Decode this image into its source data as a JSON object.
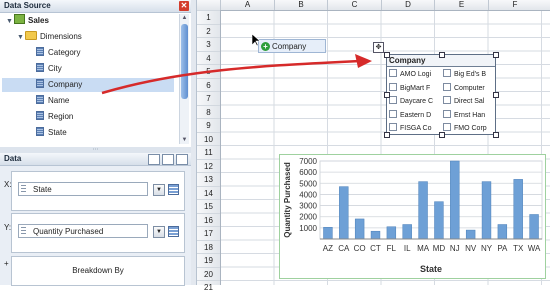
{
  "data_source": {
    "title": "Data Source",
    "tree": [
      {
        "label": "Sales",
        "indent": 0,
        "kind": "cube",
        "expanded": true
      },
      {
        "label": "Dimensions",
        "indent": 1,
        "kind": "folder",
        "expanded": true
      },
      {
        "label": "Category",
        "indent": 2,
        "kind": "field"
      },
      {
        "label": "City",
        "indent": 2,
        "kind": "field"
      },
      {
        "label": "Company",
        "indent": 2,
        "kind": "field",
        "selected": true
      },
      {
        "label": "Name",
        "indent": 2,
        "kind": "field"
      },
      {
        "label": "Region",
        "indent": 2,
        "kind": "field"
      },
      {
        "label": "State",
        "indent": 2,
        "kind": "field"
      }
    ]
  },
  "data_panel": {
    "title": "Data",
    "x_label": "X:",
    "x_value": "State",
    "y_label": "Y:",
    "y_value": "Quantity Purchased",
    "plus_label": "+",
    "breakdown_label": "Breakdown By"
  },
  "sheet": {
    "columns": [
      "A",
      "B",
      "C",
      "D",
      "E",
      "F"
    ],
    "rows": [
      "1",
      "2",
      "3",
      "4",
      "5",
      "6",
      "7",
      "8",
      "9",
      "10",
      "11",
      "12",
      "13",
      "14",
      "15",
      "16",
      "17",
      "18",
      "19",
      "20",
      "21"
    ]
  },
  "drag_chip": {
    "label": "Company"
  },
  "list_widget": {
    "title": "Company",
    "items_left": [
      "AMO Logi",
      "BigMart F",
      "Daycare C",
      "Eastern D",
      "FISGA Co"
    ],
    "items_right": [
      "Big Ed's B",
      "Computer",
      "Direct Sal",
      "Ernst Han",
      "FMO Corp"
    ]
  },
  "chart_data": {
    "type": "bar",
    "xlabel": "State",
    "ylabel": "Quantity Purchased",
    "categories": [
      "AZ",
      "CA",
      "CO",
      "CT",
      "FL",
      "IL",
      "MA",
      "MD",
      "NJ",
      "NV",
      "NY",
      "PA",
      "TX",
      "WA"
    ],
    "values": [
      1050,
      4700,
      1800,
      700,
      1100,
      1300,
      5150,
      3350,
      7000,
      800,
      5150,
      1300,
      5350,
      2200
    ],
    "ylim": [
      0,
      7000
    ],
    "yticks": [
      1000,
      2000,
      3000,
      4000,
      5000,
      6000,
      7000
    ],
    "grid": true,
    "bar_color": "#6ea0d6"
  },
  "colors": {
    "accent": "#5f8fd0",
    "arrow": "#d62a2a",
    "chart_border": "#9fd19f"
  }
}
